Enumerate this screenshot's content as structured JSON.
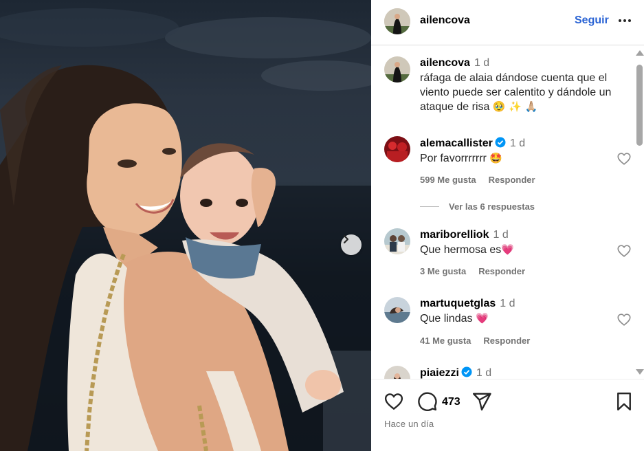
{
  "post": {
    "author": "ailencova",
    "follow_label": "Seguir",
    "caption": {
      "time": "1 d",
      "text": "ráfaga de alaia dándose cuenta que el viento puede ser calentito y dándole un ataque de risa",
      "emojis": "🥹 ✨ 🙏🏼"
    },
    "likes_label": "473",
    "posted_ago": "Hace un día"
  },
  "comments": [
    {
      "user": "alemacallister",
      "verified": true,
      "time": "1 d",
      "text": "Por favorrrrrrr",
      "emoji": "🤩",
      "likes": "599 Me gusta",
      "reply": "Responder"
    },
    {
      "user": "mariborelliok",
      "verified": false,
      "time": "1 d",
      "text": "Que hermosa es",
      "emoji": "💗",
      "likes": "3 Me gusta",
      "reply": "Responder"
    },
    {
      "user": "martuquetglas",
      "verified": false,
      "time": "1 d",
      "text": "Que lindas",
      "emoji": "💗",
      "likes": "41 Me gusta",
      "reply": "Responder"
    },
    {
      "user": "piaiezzi",
      "verified": true,
      "time": "1 d"
    }
  ],
  "view_replies": "Ver las 6 respuestas",
  "icons": {
    "more": "more-horizontal-icon",
    "next": "chevron-right-icon",
    "like": "heart-icon",
    "comment": "comment-bubble-icon",
    "share": "paper-plane-icon",
    "save": "bookmark-icon",
    "verified": "verified-badge-icon"
  },
  "colors": {
    "accent": "#2a63d4",
    "verified": "#0095f6",
    "muted": "#737373"
  }
}
